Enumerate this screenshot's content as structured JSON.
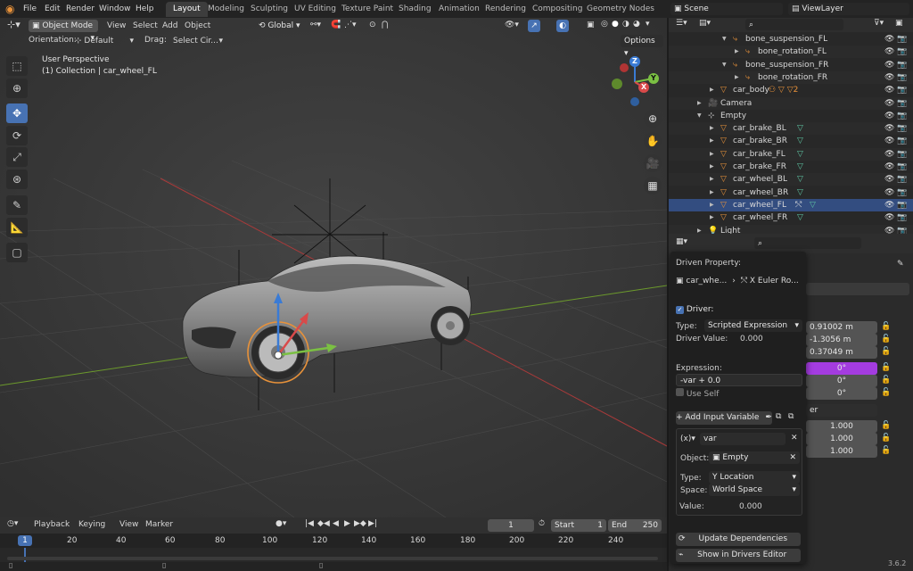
{
  "topbar": {
    "menus": [
      "File",
      "Edit",
      "Render",
      "Window",
      "Help"
    ],
    "workspaces": [
      "Layout",
      "Modeling",
      "Sculpting",
      "UV Editing",
      "Texture Paint",
      "Shading",
      "Animation",
      "Rendering",
      "Compositing",
      "Geometry Nodes"
    ],
    "scene_name": "Scene",
    "view_layer": "ViewLayer"
  },
  "viewport": {
    "mode": "Object Mode",
    "menus": [
      "View",
      "Select",
      "Add",
      "Object"
    ],
    "orientation_label": "Orientation:",
    "orientation_value": "Default",
    "drag_label": "Drag:",
    "drag_value": "Select Cir...",
    "transform_space": "Global",
    "options_label": "Options",
    "overlay_title": "User Perspective",
    "overlay_subtitle": "(1) Collection | car_wheel_FL",
    "gizmo_axes": [
      "Z",
      "Y",
      "X"
    ]
  },
  "timeline": {
    "menus": [
      "Playback",
      "Keying",
      "View",
      "Marker"
    ],
    "current_frame": "1",
    "start_label": "Start",
    "start_value": "1",
    "end_label": "End",
    "end_value": "250",
    "ruler": [
      "1",
      "20",
      "40",
      "60",
      "80",
      "100",
      "120",
      "140",
      "160",
      "180",
      "200",
      "220",
      "240"
    ]
  },
  "outliner": {
    "rows": [
      {
        "label": "bone_suspension_FL",
        "depth": 3
      },
      {
        "label": "bone_rotation_FL",
        "depth": 4
      },
      {
        "label": "bone_suspension_FR",
        "depth": 3
      },
      {
        "label": "bone_rotation_FR",
        "depth": 4
      },
      {
        "label": "car_body",
        "depth": 2,
        "badge": "2"
      },
      {
        "label": "Camera",
        "depth": 1
      },
      {
        "label": "Empty",
        "depth": 1
      },
      {
        "label": "car_brake_BL",
        "depth": 2
      },
      {
        "label": "car_brake_BR",
        "depth": 2
      },
      {
        "label": "car_brake_FL",
        "depth": 2
      },
      {
        "label": "car_brake_FR",
        "depth": 2
      },
      {
        "label": "car_wheel_BL",
        "depth": 2
      },
      {
        "label": "car_wheel_BR",
        "depth": 2
      },
      {
        "label": "car_wheel_FL",
        "depth": 2,
        "selected": true
      },
      {
        "label": "car_wheel_FR",
        "depth": 2
      },
      {
        "label": "Light",
        "depth": 1
      }
    ]
  },
  "properties": {
    "values": [
      "0.91002 m",
      "-1.3056 m",
      "0.37049 m",
      "0°",
      "0°",
      "0°",
      "er",
      "1.000",
      "1.000",
      "1.000"
    ]
  },
  "driver_popup": {
    "driven_property_label": "Driven Property:",
    "driven_object": "car_whe...",
    "driven_channel": "X Euler Ro...",
    "driver_label": "Driver:",
    "type_label": "Type:",
    "type_value": "Scripted Expression",
    "driver_value_label": "Driver Value:",
    "driver_value": "0.000",
    "expression_label": "Expression:",
    "expression_value": "-var + 0.0",
    "use_self_label": "Use Self",
    "add_variable_label": "Add Input Variable",
    "variable_prefix": "(x)",
    "variable_name": "var",
    "object_label": "Object:",
    "object_value": "Empty",
    "var_type_label": "Type:",
    "var_type_value": "Y Location",
    "space_label": "Space:",
    "space_value": "World Space",
    "value_label": "Value:",
    "value": "0.000",
    "update_deps": "Update Dependencies",
    "show_in_editor": "Show in Drivers Editor"
  },
  "statusbar": {
    "version": "3.6.2"
  },
  "colors": {
    "accent": "#4772b3",
    "selected_row": "#334d80",
    "object_orange": "#e8923a",
    "mesh_green": "#5fc7a4",
    "driver_purple": "#a43ce0"
  }
}
